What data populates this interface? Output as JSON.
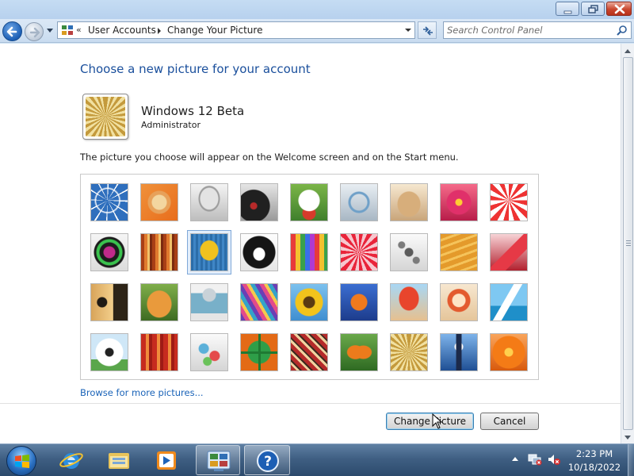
{
  "window": {
    "controls": {
      "minimize": "minimize-icon",
      "maximize": "restore-icon",
      "close": "close-icon"
    }
  },
  "nav": {
    "breadcrumb_chevron": "«",
    "breadcrumb": [
      "User Accounts",
      "Change Your Picture"
    ],
    "search_placeholder": "Search Control Panel"
  },
  "page": {
    "heading": "Choose a new picture for your account",
    "user": {
      "name": "Windows 12 Beta",
      "role": "Administrator"
    },
    "description": "The picture you choose will appear on the Welcome screen and on the Start menu.",
    "pictures": [
      "ferris-wheel",
      "starfish",
      "robot-toy",
      "vinyl-record",
      "lucky-cat",
      "gyroscope",
      "kitten",
      "flower-pink",
      "pinwheel",
      "ball-purple",
      "fabric-stripes",
      "yellow-leaf",
      "border-collie",
      "crayons",
      "red-star",
      "jacks",
      "stairs",
      "origami-crane",
      "guitar",
      "pomeranian",
      "robot-tin",
      "silk-scarves",
      "sunflower",
      "tropical-fish",
      "hot-air-balloon",
      "kokeshi-doll",
      "sailboat",
      "soccer-ball",
      "red-fabric",
      "marbles",
      "green-window",
      "woven-pattern",
      "butterfly",
      "spiral-shell",
      "lighthouse",
      "orange-flower"
    ],
    "selected_index": 11,
    "browse_link": "Browse for more pictures...",
    "buttons": {
      "change": "Change Picture",
      "cancel": "Cancel"
    }
  },
  "taskbar": {
    "pinned": [
      "internet-explorer-icon",
      "windows-explorer-icon",
      "media-player-icon",
      "control-panel-icon",
      "help-icon"
    ],
    "clock": {
      "time": "2:23 PM",
      "date": "10/18/2022"
    }
  }
}
